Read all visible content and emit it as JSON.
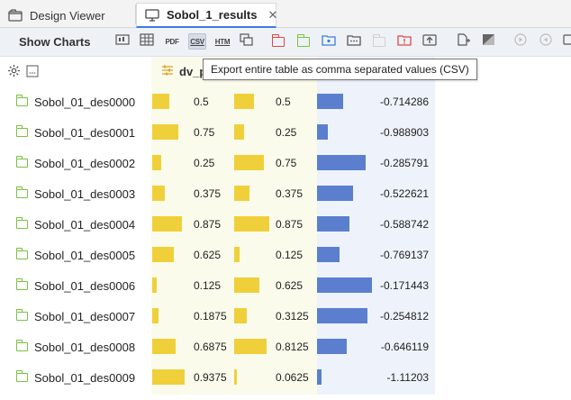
{
  "tabs": [
    {
      "label": "Design Viewer",
      "icon": "design-viewer-icon"
    },
    {
      "label": "Sobol_1_results",
      "icon": "monitor-icon",
      "close": "✕"
    }
  ],
  "toolbar": {
    "show_charts": "Show Charts",
    "pdf_label": "PDF",
    "csv_label": "CSV",
    "htm_label": "HTM"
  },
  "tooltip": "Export entire table as comma separated values (CSV)",
  "table": {
    "column_header": "dv_p",
    "colors": {
      "yellow": "#f0d03a",
      "blue": "#5b7fce",
      "folder": "#7ac142",
      "col_bg_yellow": "#fbfbec",
      "col_bg_blue": "#eef3fb"
    },
    "rows": [
      {
        "name": "Sobol_01_des0000",
        "v1": "0.5",
        "v2": "0.5",
        "v3": "-0.714286",
        "f1": 0.5,
        "f2": 0.5,
        "n3": -0.714286
      },
      {
        "name": "Sobol_01_des0001",
        "v1": "0.75",
        "v2": "0.25",
        "v3": "-0.988903",
        "f1": 0.75,
        "f2": 0.25,
        "n3": -0.988903
      },
      {
        "name": "Sobol_01_des0002",
        "v1": "0.25",
        "v2": "0.75",
        "v3": "-0.285791",
        "f1": 0.25,
        "f2": 0.75,
        "n3": -0.285791
      },
      {
        "name": "Sobol_01_des0003",
        "v1": "0.375",
        "v2": "0.375",
        "v3": "-0.522621",
        "f1": 0.375,
        "f2": 0.375,
        "n3": -0.522621
      },
      {
        "name": "Sobol_01_des0004",
        "v1": "0.875",
        "v2": "0.875",
        "v3": "-0.588742",
        "f1": 0.875,
        "f2": 0.875,
        "n3": -0.588742
      },
      {
        "name": "Sobol_01_des0005",
        "v1": "0.625",
        "v2": "0.125",
        "v3": "-0.769137",
        "f1": 0.625,
        "f2": 0.125,
        "n3": -0.769137
      },
      {
        "name": "Sobol_01_des0006",
        "v1": "0.125",
        "v2": "0.625",
        "v3": "-0.171443",
        "f1": 0.125,
        "f2": 0.625,
        "n3": -0.171443
      },
      {
        "name": "Sobol_01_des0007",
        "v1": "0.1875",
        "v2": "0.3125",
        "v3": "-0.254812",
        "f1": 0.1875,
        "f2": 0.3125,
        "n3": -0.254812
      },
      {
        "name": "Sobol_01_des0008",
        "v1": "0.6875",
        "v2": "0.8125",
        "v3": "-0.646119",
        "f1": 0.6875,
        "f2": 0.8125,
        "n3": -0.646119
      },
      {
        "name": "Sobol_01_des0009",
        "v1": "0.9375",
        "v2": "0.0625",
        "v3": "-1.11203",
        "f1": 0.9375,
        "f2": 0.0625,
        "n3": -1.11203
      }
    ]
  }
}
